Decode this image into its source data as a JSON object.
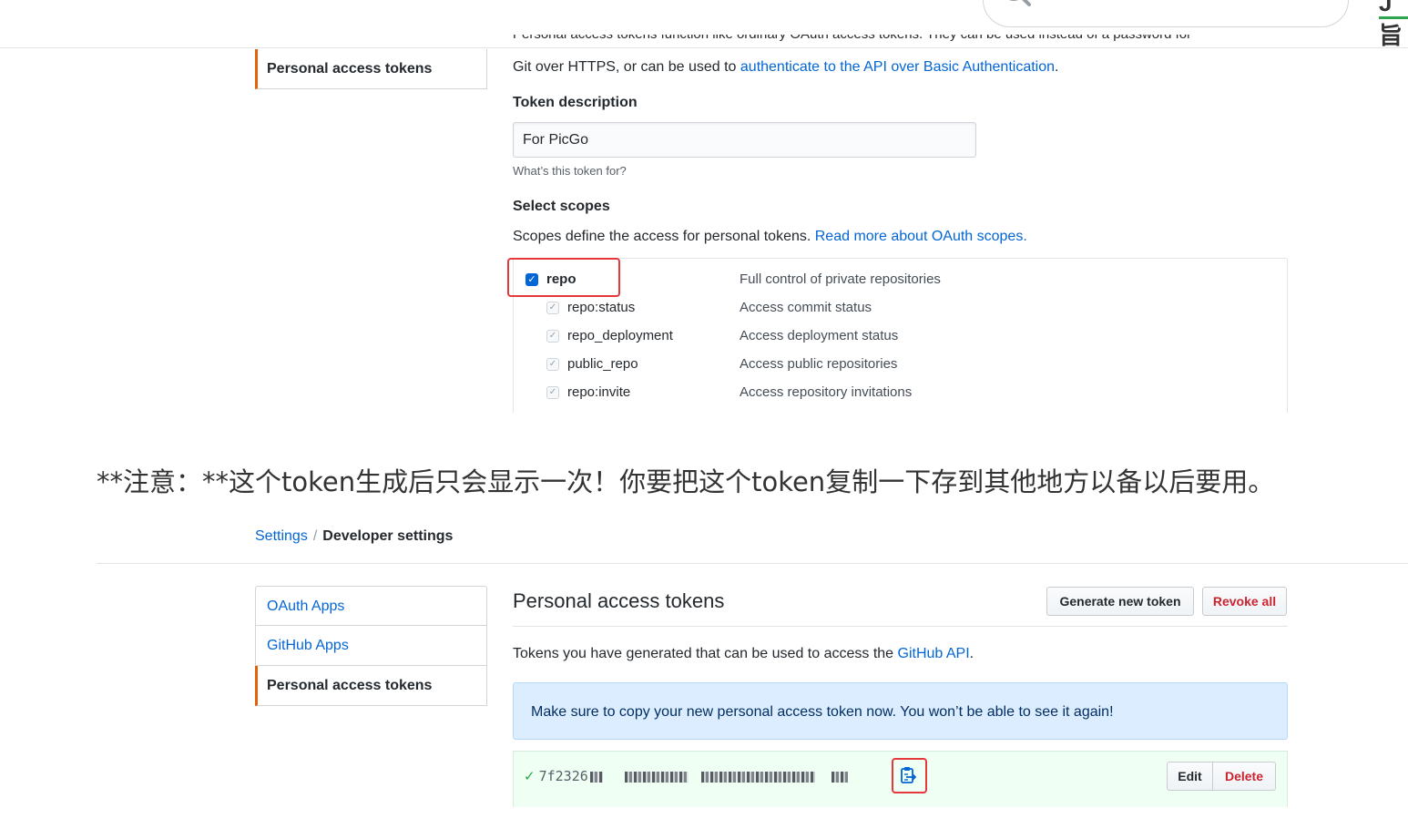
{
  "top_panel": {
    "sidebar_selected": "Personal access tokens",
    "intro_cut": "Personal access tokens function like ordinary OAuth access tokens. They can be used instead of a password for",
    "intro_prefix": "Git over HTTPS, or can be used to ",
    "intro_link": "authenticate to the API over Basic Authentication",
    "intro_suffix": ".",
    "token_description_label": "Token description",
    "token_description_value": "For PicGo",
    "token_description_note": "What’s this token for?",
    "select_scopes_label": "Select scopes",
    "scopes_text": "Scopes define the access for personal tokens. ",
    "scopes_link": "Read more about OAuth scopes.",
    "scopes": [
      {
        "name": "repo",
        "description": "Full control of private repositories",
        "checked": true
      },
      {
        "name": "repo:status",
        "description": "Access commit status",
        "checked": true
      },
      {
        "name": "repo_deployment",
        "description": "Access deployment status",
        "checked": true
      },
      {
        "name": "public_repo",
        "description": "Access public repositories",
        "checked": true
      },
      {
        "name": "repo:invite",
        "description": "Access repository invitations",
        "checked": true
      }
    ]
  },
  "caption": "**注意：**这个token生成后只会显示一次！你要把这个token复制一下存到其他地方以备以后要用。",
  "bottom_panel": {
    "breadcrumb": [
      "Settings",
      "Developer settings"
    ],
    "sidebar": [
      {
        "label": "OAuth Apps",
        "selected": false
      },
      {
        "label": "GitHub Apps",
        "selected": false
      },
      {
        "label": "Personal access tokens",
        "selected": true
      }
    ],
    "title": "Personal access tokens",
    "generate_button": "Generate new token",
    "revoke_button": "Revoke all",
    "tokens_text": "Tokens you have generated that can be used to access the ",
    "tokens_link": "GitHub API",
    "tokens_suffix": ".",
    "flash_message": "Make sure to copy your new personal access token now. You won’t be able to see it again!",
    "token_prefix": "7f2326",
    "edit_button": "Edit",
    "delete_button": "Delete"
  },
  "colors": {
    "link": "#0366d6",
    "selected_accent": "#e36209",
    "highlight_box": "#e5383b",
    "danger": "#cb2431",
    "success": "#28a745"
  },
  "icons": [
    "search-icon",
    "checkbox-checked-icon",
    "check-icon",
    "clipboard-copy-icon"
  ]
}
